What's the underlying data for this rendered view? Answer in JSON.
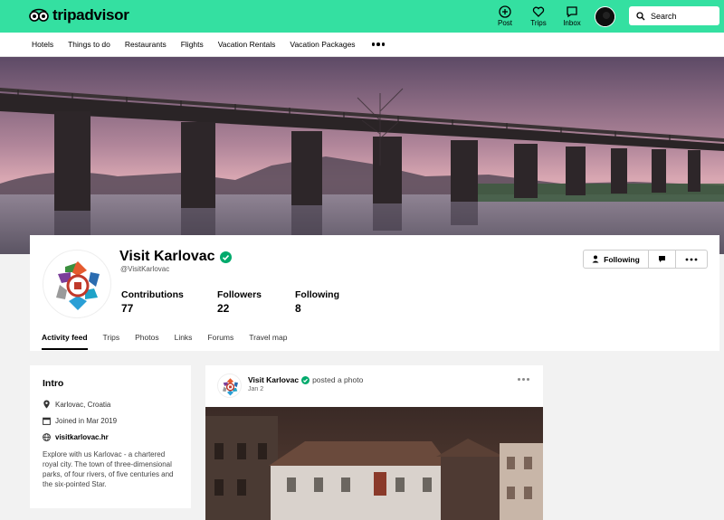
{
  "brand": {
    "name": "tripadvisor",
    "accent": "#34e0a1"
  },
  "topnav": {
    "post": "Post",
    "trips": "Trips",
    "inbox": "Inbox",
    "search_label": "Search"
  },
  "subnav": {
    "items": [
      "Hotels",
      "Things to do",
      "Restaurants",
      "Flights",
      "Vacation Rentals",
      "Vacation Packages"
    ]
  },
  "profile": {
    "name": "Visit Karlovac",
    "handle": "@VisitKarlovac",
    "stats": [
      {
        "label": "Contributions",
        "value": "77"
      },
      {
        "label": "Followers",
        "value": "22"
      },
      {
        "label": "Following",
        "value": "8"
      }
    ],
    "follow_button": "Following",
    "tabs": [
      "Activity feed",
      "Trips",
      "Photos",
      "Links",
      "Forums",
      "Travel map"
    ],
    "active_tab": "Activity feed"
  },
  "intro": {
    "title": "Intro",
    "location": "Karlovac, Croatia",
    "joined": "Joined in Mar 2019",
    "website": "visitkarlovac.hr",
    "description": "Explore with us Karlovac - a chartered royal city. The town of three-dimensional parks, of four rivers, of five centuries and the six-pointed Star."
  },
  "post": {
    "author": "Visit Karlovac",
    "action": "posted a photo",
    "date": "Jan 2"
  }
}
